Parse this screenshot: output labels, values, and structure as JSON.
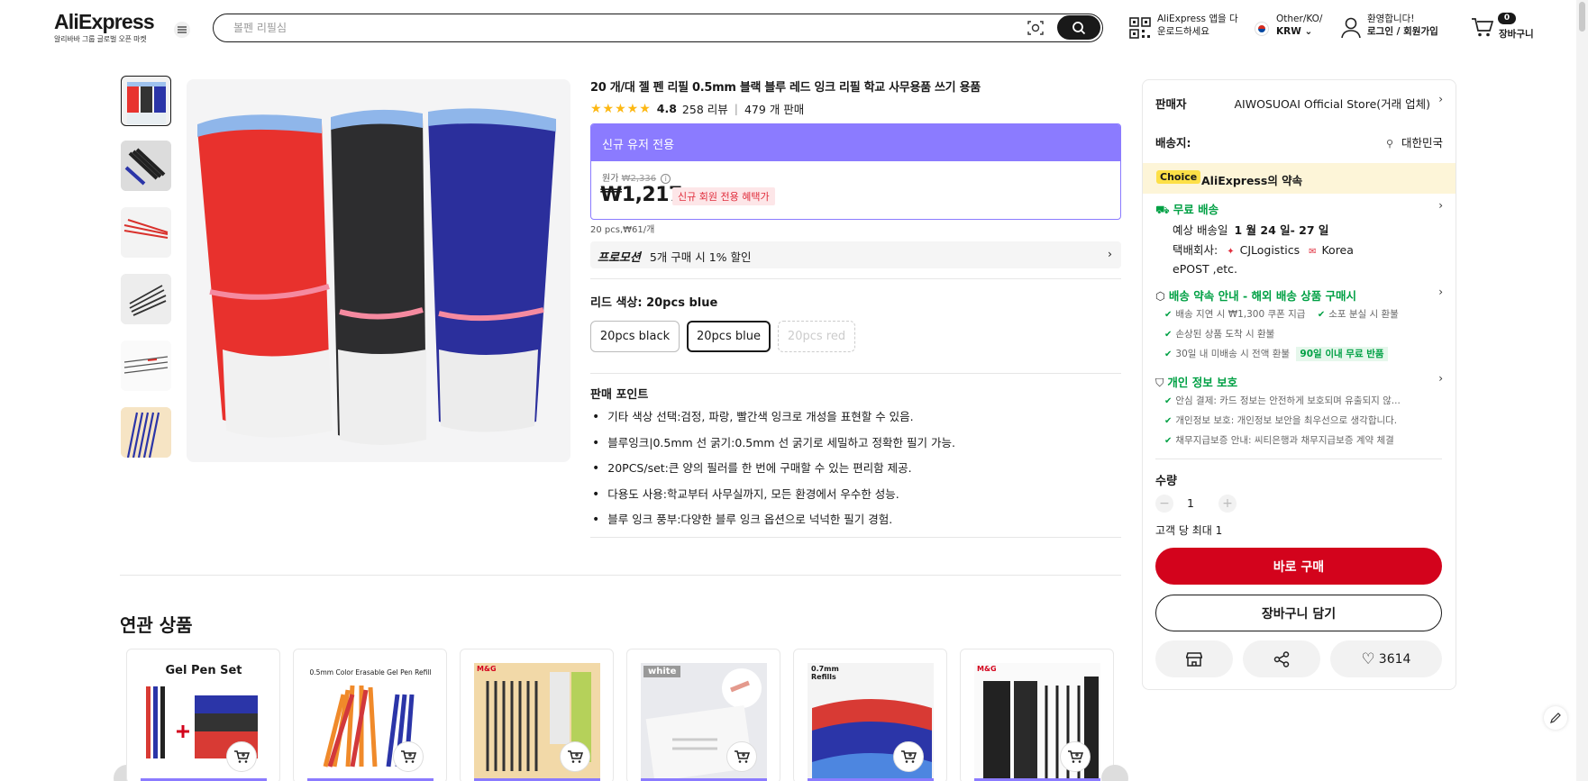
{
  "header": {
    "logo": "AliExpress",
    "logo_sub": "알리바바 그룹 글로벌 오픈 마켓",
    "search_placeholder": "볼펜 리필심",
    "app_line1": "AliExpress 앱을 다",
    "app_line2": "운로드하세요",
    "region_line1": "Other/KO/",
    "region_line2": "KRW",
    "account_line1": "환영합니다!",
    "account_line2": "로그인 / 회원가입",
    "cart_count": "0",
    "cart_label": "장바구니"
  },
  "product": {
    "title": "20 개/대 젤 펜 리필 0.5mm 블랙 블루 레드 잉크 리필 학교 사무용품 쓰기 용품",
    "stars": "★★★★★",
    "rating": "4.8",
    "reviews": "258 리뷰",
    "sold": "479 개 판매",
    "price_header": "신규 유저 전용",
    "orig_label": "원가",
    "orig_price": "₩2,336",
    "price": "₩1,217",
    "new_badge": "신규 회원 전용 혜택가",
    "per_piece": "20 pcs,₩61/개",
    "promo_label": "프로모션",
    "promo_text": "5개 구매 시 1% 할인",
    "color_label": "리드 색상: 20pcs blue",
    "options": [
      "20pcs black",
      "20pcs blue",
      "20pcs red"
    ],
    "selling_points_title": "판매 포인트",
    "selling_points": [
      "기타 색상 선택:검정, 파랑, 빨간색 잉크로 개성을 표현할 수 있음.",
      "블루잉크|0.5mm 선 굵기:0.5mm 선 굵기로 세밀하고 정확한 필기 가능.",
      "20PCS/set:큰 양의 필러를 한 번에 구매할 수 있는 편리함 제공.",
      "다용도 사용:학교부터 사무실까지, 모든 환경에서 우수한 성능.",
      "블루 잉크 풍부:다양한 블루 잉크 옵션으로 넉넉한 필기 경험."
    ]
  },
  "panel": {
    "seller_label": "판매자",
    "seller_name": "AIWOSUOAI Official Store(거래 업체)",
    "ship_to_label": "배송지:",
    "ship_to": "대한민국",
    "choice_tag": "Choice",
    "choice_text": "AliExpress의 약속",
    "free_ship": "무료 배송",
    "eta_prefix": "예상 배송일",
    "eta": "1 월 24 일- 27 일",
    "carrier_label": "택배회사:",
    "carrier1": "CJLogistics",
    "carrier2": "Korea",
    "carrier3": "ePOST ,etc.",
    "promise_title": "배송 약속 안내 - 해외 배송 상품 구매시",
    "promise_items": [
      "배송 지연 시 ₩1,300 쿠폰 지급",
      "소포 분실 시 환불",
      "손상된 상품 도착 시 환불",
      "30일 내 미배송 시 전액 환불"
    ],
    "return_badge": "90일 이내 무료 반품",
    "privacy_title": "개인 정보 보호",
    "privacy_items": [
      "안심 결제: 카드 정보는 안전하게 보호되며 유출되지 않...",
      "개인정보 보호: 개인정보 보안을 최우선으로 생각합니다.",
      "채무지급보증 안내: 씨티은행과 채무지급보증 계약 체결"
    ],
    "qty_label": "수량",
    "qty_value": "1",
    "max_text": "고객 당 최대 1",
    "buy_now": "바로 구매",
    "add_cart": "장바구니 담기",
    "wish_count": "3614"
  },
  "related": {
    "title": "연관 상품",
    "card_texts": [
      "Gel Pen Set",
      "0.5mm Color Erasable Gel Pen Refill",
      "M&G",
      "white",
      "0.7mm Refills",
      "M&G"
    ]
  },
  "colors": {
    "brand_red": "#d3031c",
    "promo_purple": "#8b7bff",
    "green": "#00a044",
    "star": "#fdb813"
  }
}
